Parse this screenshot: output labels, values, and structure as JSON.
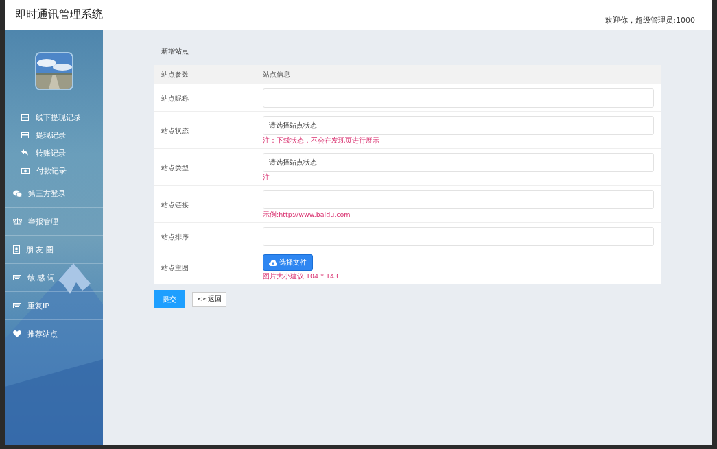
{
  "header": {
    "title": "即时通讯管理系统",
    "welcome": "欢迎你，超级管理员:1000"
  },
  "sidebar": {
    "items": [
      {
        "label": "线下提现记录",
        "kind": "sub"
      },
      {
        "label": "提现记录",
        "kind": "sub"
      },
      {
        "label": "转账记录",
        "kind": "sub"
      },
      {
        "label": "付款记录",
        "kind": "sub"
      },
      {
        "label": "第三方登录",
        "kind": "top"
      },
      {
        "label": "举报管理",
        "kind": "top"
      },
      {
        "label": "朋 友 圈",
        "kind": "top"
      },
      {
        "label": "敏 感 词",
        "kind": "top"
      },
      {
        "label": "重复IP",
        "kind": "top"
      },
      {
        "label": "推荐站点",
        "kind": "top"
      }
    ]
  },
  "page": {
    "title": "新增站点",
    "columns": [
      "站点参数",
      "站点信息"
    ],
    "rows": [
      {
        "label": "站点昵称",
        "kind": "input"
      },
      {
        "label": "站点状态",
        "kind": "select",
        "value": "请选择站点状态",
        "note": "注：下线状态，不会在发现页进行展示"
      },
      {
        "label": "站点类型",
        "kind": "select",
        "value": "请选择站点状态",
        "note": "注"
      },
      {
        "label": "站点链接",
        "kind": "input",
        "note": "示例:http://www.baidu.com"
      },
      {
        "label": "站点排序",
        "kind": "input"
      },
      {
        "label": "站点主图",
        "kind": "file",
        "button": "选择文件",
        "note": "图片大小建议 104 * 143"
      }
    ],
    "submit": "提交",
    "back": "<<返回"
  }
}
